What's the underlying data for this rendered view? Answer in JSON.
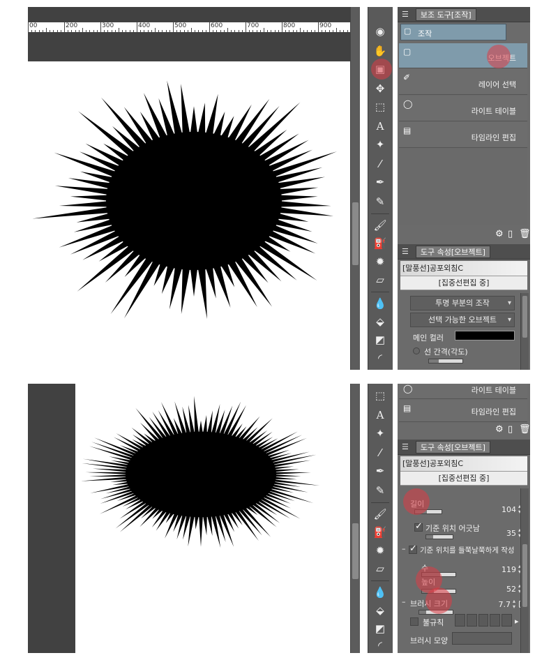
{
  "ruler": {
    "labels": [
      "00",
      "200",
      "300",
      "400",
      "500",
      "600",
      "700",
      "800",
      "900"
    ]
  },
  "panels_top": {
    "subtool_header": "보조 도구[조작]",
    "group_label": "조작",
    "subtools": [
      {
        "label": "오브젝트",
        "icon": "object-tool-icon",
        "selected": true
      },
      {
        "label": "레이어 선택",
        "icon": "layer-select-icon",
        "selected": false
      },
      {
        "label": "라이트 테이블",
        "icon": "light-table-icon",
        "selected": false
      },
      {
        "label": "타임라인 편집",
        "icon": "timeline-edit-icon",
        "selected": false
      }
    ],
    "tool_property_header": "도구 속성[오브젝트]",
    "object_name": "[말풍선]공포외침C",
    "editing_status": "[집중선편집 중]",
    "transparent_op": "투명 부분의 조작",
    "selectable_obj": "선택 가능한 오브젝트",
    "main_color_label": "메인 컬러",
    "main_color": "#000000",
    "line_interval_label": "선 간격(각도)"
  },
  "panels_bottom": {
    "subtools": [
      {
        "label": "라이트 테이블"
      },
      {
        "label": "타임라인 편집"
      }
    ],
    "tool_property_header": "도구 속성[오브젝트]",
    "object_name": "[말풍선]공포외침C",
    "editing_status": "[집중선편집 중]",
    "length_label": "길이",
    "length_value": "104",
    "offset_label": "기준 위치 어긋남",
    "offset_value": "35",
    "uneven_label": "기준 위치를 들쭉날쭉하게 작성",
    "count_label": "수",
    "count_value": "119",
    "height_label": "높이",
    "height_value": "52",
    "brush_size_label": "브러시 크기",
    "brush_size_value": "7.7",
    "irregular_label": "불규칙",
    "brush_shape_label": "브러시 모양"
  },
  "colors": {
    "highlight": "#dc3c46",
    "selected_item": "#7f9bab",
    "panel": "#6b6b6b"
  }
}
